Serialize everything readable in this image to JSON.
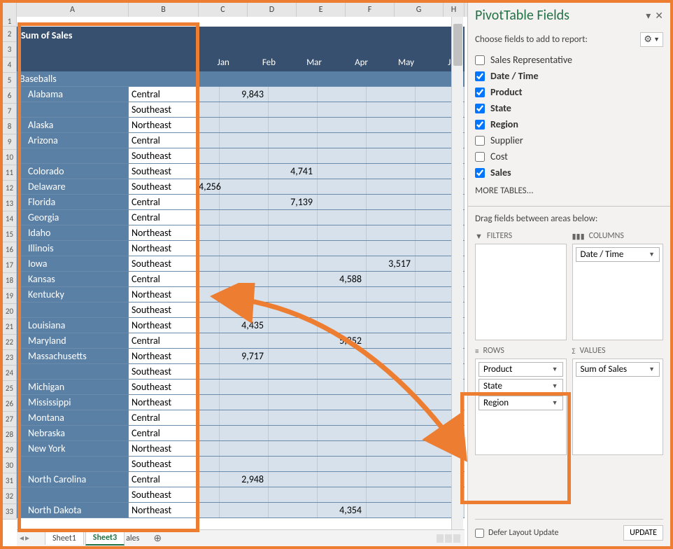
{
  "columns": [
    "A",
    "B",
    "C",
    "D",
    "E",
    "F",
    "G",
    "H"
  ],
  "row_numbers": [
    "1",
    "2",
    "3",
    "4",
    "5",
    "6",
    "7",
    "8",
    "9",
    "10",
    "11",
    "12",
    "13",
    "14",
    "15",
    "16",
    "17",
    "18",
    "19",
    "20",
    "21",
    "22",
    "23",
    "24",
    "25",
    "26",
    "27",
    "28",
    "29",
    "30",
    "31",
    "32",
    "33"
  ],
  "pivot_title": "Sum of Sales",
  "months": [
    "Jan",
    "Feb",
    "Mar",
    "Apr",
    "May",
    "Jun"
  ],
  "category": "Baseballs",
  "rows": [
    {
      "state": "Alabama",
      "region": "Central",
      "vals": {
        "Feb": "9,843"
      }
    },
    {
      "state": "",
      "region": "Southeast",
      "vals": {}
    },
    {
      "state": "Alaska",
      "region": "Northeast",
      "vals": {}
    },
    {
      "state": "Arizona",
      "region": "Central",
      "vals": {}
    },
    {
      "state": "",
      "region": "Southeast",
      "vals": {}
    },
    {
      "state": "Colorado",
      "region": "Southeast",
      "vals": {
        "Mar": "4,741"
      }
    },
    {
      "state": "Delaware",
      "region": "Southeast",
      "vals": {
        "Jan": "4,256"
      }
    },
    {
      "state": "Florida",
      "region": "Central",
      "vals": {
        "Mar": "7,139"
      }
    },
    {
      "state": "Georgia",
      "region": "Central",
      "vals": {}
    },
    {
      "state": "Idaho",
      "region": "Northeast",
      "vals": {}
    },
    {
      "state": "Illinois",
      "region": "Northeast",
      "vals": {}
    },
    {
      "state": "Iowa",
      "region": "Southeast",
      "vals": {
        "May": "3,517"
      }
    },
    {
      "state": "Kansas",
      "region": "Central",
      "vals": {
        "Apr": "4,588"
      }
    },
    {
      "state": "Kentucky",
      "region": "Northeast",
      "vals": {}
    },
    {
      "state": "",
      "region": "Southeast",
      "vals": {}
    },
    {
      "state": "Louisiana",
      "region": "Northeast",
      "vals": {
        "Feb": "4,435"
      }
    },
    {
      "state": "Maryland",
      "region": "Central",
      "vals": {
        "Apr": "5,852"
      }
    },
    {
      "state": "Massachusetts",
      "region": "Northeast",
      "vals": {
        "Feb": "9,717"
      }
    },
    {
      "state": "",
      "region": "Southeast",
      "vals": {}
    },
    {
      "state": "Michigan",
      "region": "Southeast",
      "vals": {}
    },
    {
      "state": "Mississippi",
      "region": "Northeast",
      "vals": {}
    },
    {
      "state": "Montana",
      "region": "Central",
      "vals": {}
    },
    {
      "state": "Nebraska",
      "region": "Central",
      "vals": {}
    },
    {
      "state": "New York",
      "region": "Northeast",
      "vals": {}
    },
    {
      "state": "",
      "region": "Southeast",
      "vals": {}
    },
    {
      "state": "North Carolina",
      "region": "Central",
      "vals": {
        "Feb": "2,948"
      }
    },
    {
      "state": "",
      "region": "Southeast",
      "vals": {}
    },
    {
      "state": "North Dakota",
      "region": "Northeast",
      "vals": {
        "Apr": "4,354"
      }
    }
  ],
  "sheet_tabs": {
    "inactive": "Sheet1",
    "active": "Sheet3",
    "extra": "ales"
  },
  "pane": {
    "title": "PivotTable Fields",
    "instruction": "Choose fields to add to report:",
    "fields": [
      {
        "label": "Sales Representative",
        "checked": false
      },
      {
        "label": "Date / Time",
        "checked": true
      },
      {
        "label": "Product",
        "checked": true
      },
      {
        "label": "State",
        "checked": true
      },
      {
        "label": "Region",
        "checked": true
      },
      {
        "label": "Supplier",
        "checked": false
      },
      {
        "label": "Cost",
        "checked": false
      },
      {
        "label": "Sales",
        "checked": true
      }
    ],
    "more_tables": "MORE TABLES...",
    "drag_text": "Drag fields between areas below:",
    "areas": {
      "filters": {
        "header": "FILTERS",
        "items": []
      },
      "columns": {
        "header": "COLUMNS",
        "items": [
          "Date / Time"
        ]
      },
      "rows": {
        "header": "ROWS",
        "items": [
          "Product",
          "State",
          "Region"
        ]
      },
      "values": {
        "header": "VALUES",
        "items": [
          "Sum of Sales"
        ]
      }
    },
    "defer_label": "Defer Layout Update",
    "update_button": "UPDATE"
  }
}
